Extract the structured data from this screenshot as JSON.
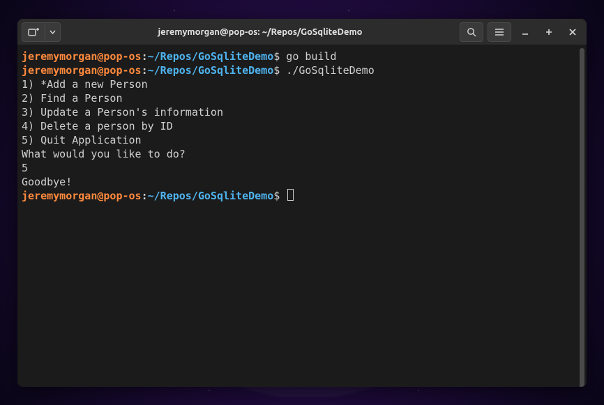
{
  "window": {
    "title": "jeremymorgan@pop-os: ~/Repos/GoSqliteDemo"
  },
  "prompt": {
    "user_host": "jeremymorgan@pop-os",
    "sep": ":",
    "path": "~/Repos/GoSqliteDemo",
    "symbol": "$"
  },
  "lines": {
    "cmd1": " go build",
    "cmd2": " ./GoSqliteDemo",
    "out1": "1) *Add a new Person",
    "out2": "2) Find a Person",
    "out3": "3) Update a Person's information",
    "out4": "4) Delete a person by ID",
    "out5": "5) Quit Application",
    "out6": "What would you like to do?",
    "out7": "5",
    "out8": "Goodbye!"
  },
  "icons": {
    "new_tab": "new-tab-icon",
    "dropdown": "chevron-down-icon",
    "search": "search-icon",
    "menu": "hamburger-icon",
    "minimize": "minimize-icon",
    "maximize": "maximize-icon",
    "close": "close-icon"
  }
}
